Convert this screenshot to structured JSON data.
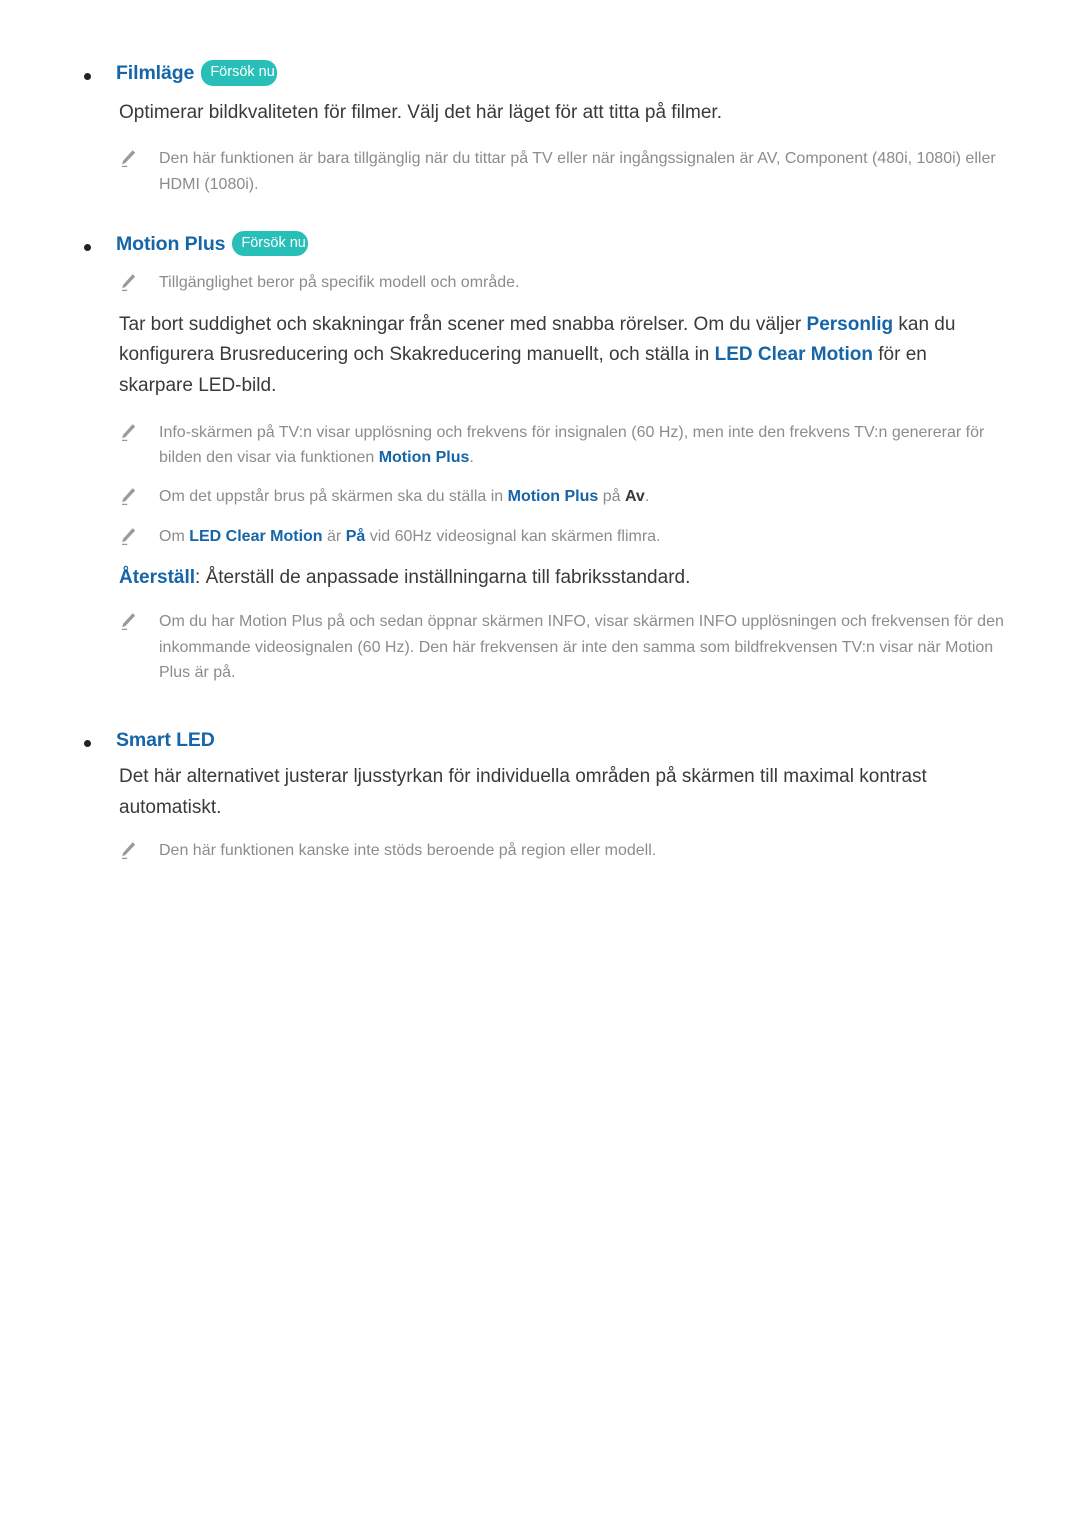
{
  "document": {
    "language": "sv",
    "colors": {
      "heading_blue": "#1565A8",
      "badge_teal": "#27BFB8",
      "body_text": "#3a3a3a",
      "note_text": "#8c8c8c",
      "bullet": "#222222"
    },
    "badge_label": "Försök nu",
    "icon_name": "pencil-note-icon"
  },
  "sections": [
    {
      "id": "film-mode",
      "title": "Filmläge",
      "has_badge": true,
      "badge": "Försök nu",
      "body": "Optimerar bildkvaliteten för filmer. Välj det här läget för att titta på filmer.",
      "notes": [
        {
          "parts": [
            {
              "text": "Den här funktionen är bara tillgänglig när du tittar på TV eller när ingångssignalen är AV, Component (480i, 1080i) eller HDMI (1080i).",
              "style": "plain"
            }
          ]
        }
      ]
    },
    {
      "id": "motion-plus",
      "title": "Motion Plus",
      "has_badge": true,
      "badge": "Försök nu",
      "pre_notes": [
        {
          "parts": [
            {
              "text": "Tillgänglighet beror på specifik modell och område.",
              "style": "plain"
            }
          ]
        }
      ],
      "body_parts": [
        {
          "text": "Tar bort suddighet och skakningar från scener med snabba rörelser. Om du väljer ",
          "style": "plain"
        },
        {
          "text": "Personlig",
          "style": "highlight"
        },
        {
          "text": " kan du konfigurera Brusreducering och Skakreducering manuellt, och ställa in ",
          "style": "plain"
        },
        {
          "text": "LED Clear Motion",
          "style": "highlight"
        },
        {
          "text": " för en skarpare LED-bild.",
          "style": "plain"
        }
      ],
      "notes": [
        {
          "parts": [
            {
              "text": "Info-skärmen på TV:n visar upplösning och frekvens för insignalen (60 Hz), men inte den frekvens TV:n genererar för bilden den visar via funktionen ",
              "style": "plain"
            },
            {
              "text": "Motion Plus",
              "style": "highlight"
            },
            {
              "text": ".",
              "style": "plain"
            }
          ]
        },
        {
          "parts": [
            {
              "text": "Om det uppstår brus på skärmen ska du ställa in ",
              "style": "plain"
            },
            {
              "text": "Motion Plus",
              "style": "highlight"
            },
            {
              "text": " på ",
              "style": "plain"
            },
            {
              "text": "Av",
              "style": "highlight-dark"
            },
            {
              "text": ".",
              "style": "plain"
            }
          ]
        },
        {
          "parts": [
            {
              "text": "Om ",
              "style": "plain"
            },
            {
              "text": "LED Clear Motion",
              "style": "highlight"
            },
            {
              "text": " är ",
              "style": "plain"
            },
            {
              "text": "På",
              "style": "highlight"
            },
            {
              "text": " vid 60Hz videosignal kan skärmen flimra.",
              "style": "plain"
            }
          ]
        }
      ],
      "reset_parts": [
        {
          "text": "Återställ",
          "style": "highlight"
        },
        {
          "text": ": Återställ de anpassade inställningarna till fabriksstandard.",
          "style": "plain"
        }
      ],
      "post_notes": [
        {
          "parts": [
            {
              "text": "Om du har Motion Plus på och sedan öppnar skärmen INFO, visar skärmen INFO upplösningen och frekvensen för den inkommande videosignalen (60 Hz). Den här frekvensen är inte den samma som bildfrekvensen TV:n visar när Motion Plus är på.",
              "style": "plain"
            }
          ]
        }
      ]
    },
    {
      "id": "smart-led",
      "title": "Smart LED",
      "has_badge": false,
      "badge": "",
      "body": "Det här alternativet justerar ljusstyrkan för individuella områden på skärmen till maximal kontrast automatiskt.",
      "notes": [
        {
          "parts": [
            {
              "text": "Den här funktionen kanske inte stöds beroende på region eller modell.",
              "style": "plain"
            }
          ]
        }
      ]
    }
  ]
}
